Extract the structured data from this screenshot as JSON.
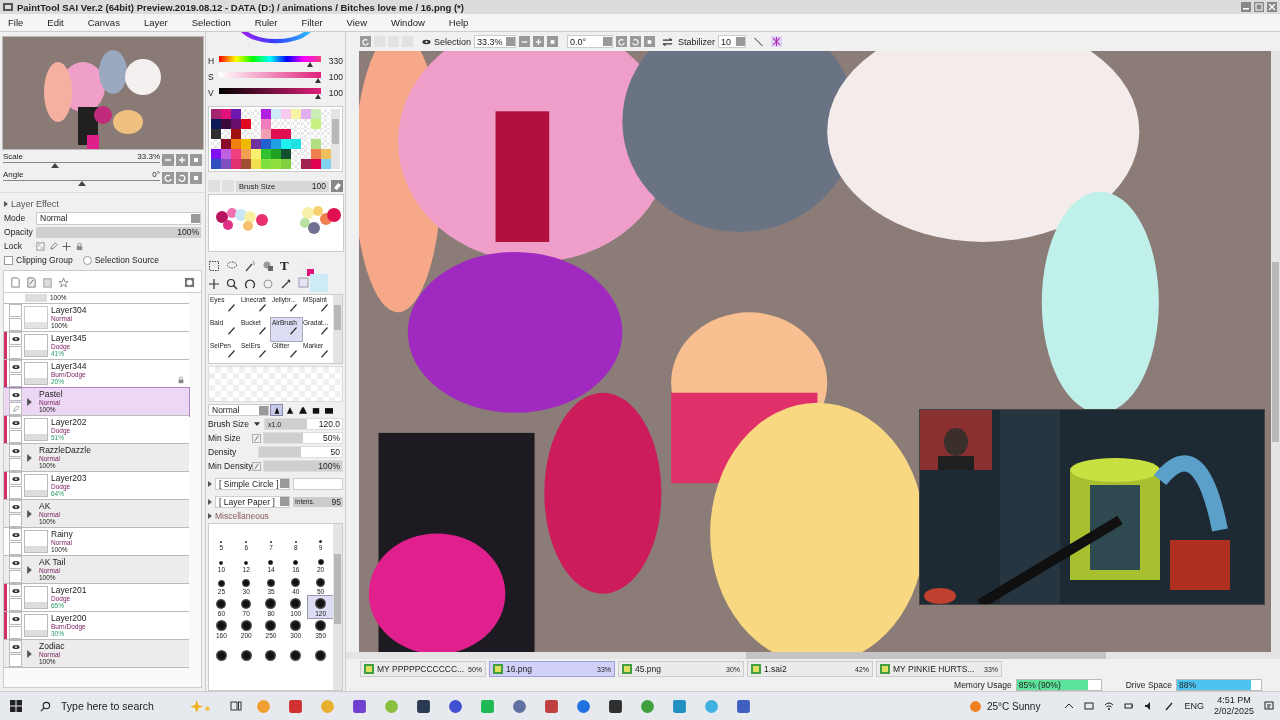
{
  "window": {
    "title": "PaintTool SAI Ver.2 (64bit) Preview.2019.08.12 - DATA (D:) / animations / Bitches love me / 16.png (*)"
  },
  "menu": [
    "File",
    "Edit",
    "Canvas",
    "Layer",
    "Selection",
    "Ruler",
    "Filter",
    "View",
    "Window",
    "Help"
  ],
  "navigator": {
    "sliders": [
      {
        "label": "Scale",
        "value": "33.3%",
        "level": 0.33
      },
      {
        "label": "Angle",
        "value": "0°",
        "level": 0.5
      }
    ]
  },
  "layer_panel": {
    "effect": {
      "label": "Layer Effect",
      "expanded": false
    },
    "mode": {
      "label": "Mode",
      "value": "Normal"
    },
    "opacity": {
      "label": "Opacity",
      "value": "100%",
      "level": 1
    },
    "lock_label": "Lock",
    "clipping_group": {
      "label": "Clipping Group",
      "checked": false
    },
    "selection_source": {
      "label": "Selection Source",
      "selected": false
    },
    "layers": [
      {
        "kind": "partial",
        "opacity": "100%",
        "visible": false,
        "clipped": false,
        "selected": false,
        "locked": false
      },
      {
        "kind": "layer",
        "name": "Layer304",
        "mode": "Normal",
        "opacity": "100%",
        "visible": false,
        "clipped": false,
        "selected": false,
        "locked": false
      },
      {
        "kind": "layer",
        "name": "Layer345",
        "mode": "Dodge",
        "opacity": "41%",
        "visible": true,
        "clipped": true,
        "selected": false,
        "locked": false
      },
      {
        "kind": "layer",
        "name": "Layer344",
        "mode": "Burn/Dodge",
        "opacity": "20%",
        "visible": true,
        "clipped": true,
        "selected": false,
        "locked": true
      },
      {
        "kind": "folder",
        "name": "Pastel",
        "mode": "Normal",
        "opacity": "100%",
        "visible": true,
        "clipped": false,
        "selected": true,
        "locked": false
      },
      {
        "kind": "layer",
        "name": "Layer202",
        "mode": "Dodge",
        "opacity": "51%",
        "visible": true,
        "clipped": true,
        "selected": false,
        "locked": false
      },
      {
        "kind": "folder",
        "name": "RazzleDazzle",
        "mode": "Normal",
        "opacity": "100%",
        "visible": true,
        "clipped": false,
        "selected": false,
        "locked": false
      },
      {
        "kind": "layer",
        "name": "Layer203",
        "mode": "Dodge",
        "opacity": "64%",
        "visible": true,
        "clipped": true,
        "selected": false,
        "locked": false
      },
      {
        "kind": "folder",
        "name": "AK",
        "mode": "Normal",
        "opacity": "100%",
        "visible": true,
        "clipped": false,
        "selected": false,
        "locked": false
      },
      {
        "kind": "layer",
        "name": "Rainy",
        "mode": "Normal",
        "opacity": "100%",
        "visible": true,
        "clipped": false,
        "selected": false,
        "locked": false
      },
      {
        "kind": "folder",
        "name": "AK Tail",
        "mode": "Normal",
        "opacity": "100%",
        "visible": true,
        "clipped": false,
        "selected": false,
        "locked": false
      },
      {
        "kind": "layer",
        "name": "Layer201",
        "mode": "Dodge",
        "opacity": "65%",
        "visible": true,
        "clipped": true,
        "selected": false,
        "locked": false
      },
      {
        "kind": "layer",
        "name": "Layer200",
        "mode": "Burn/Dodge",
        "opacity": "30%",
        "visible": true,
        "clipped": true,
        "selected": false,
        "locked": false
      },
      {
        "kind": "folder",
        "name": "Zodiac",
        "mode": "Normal",
        "opacity": "100%",
        "visible": true,
        "clipped": false,
        "selected": false,
        "locked": false
      }
    ]
  },
  "color": {
    "sliders": [
      {
        "label": "H",
        "value": "330",
        "level": 0.92
      },
      {
        "label": "S",
        "value": "100",
        "level": 1
      },
      {
        "label": "V",
        "value": "100",
        "level": 1
      }
    ],
    "swatches": [
      [
        {
          "filled": true,
          "color": "#a3246f"
        },
        {
          "filled": true,
          "color": "#e0137a"
        },
        {
          "filled": true,
          "color": "#6c18b0"
        },
        {
          "filled": false
        },
        {
          "filled": false
        },
        {
          "filled": true,
          "color": "#b11fe0"
        },
        {
          "filled": true,
          "color": "#cdeaf7"
        },
        {
          "filled": true,
          "color": "#f7c9ee"
        },
        {
          "filled": true,
          "color": "#f8f2a2"
        },
        {
          "filled": true,
          "color": "#e2aef2"
        },
        {
          "filled": true,
          "color": "#c9efb7"
        },
        {
          "filled": false
        }
      ],
      [
        {
          "filled": true,
          "color": "#0c1a5a"
        },
        {
          "filled": true,
          "color": "#3a0a3a"
        },
        {
          "filled": true,
          "color": "#6a0c6a"
        },
        {
          "filled": true,
          "color": "#e00820"
        },
        {
          "filled": false
        },
        {
          "filled": true,
          "color": "#f07cc0"
        },
        {
          "filled": false
        },
        {
          "filled": false
        },
        {
          "filled": false
        },
        {
          "filled": false
        },
        {
          "filled": true,
          "color": "#c8f080"
        },
        {
          "filled": false
        }
      ],
      [
        {
          "filled": true,
          "color": "#303030"
        },
        {
          "filled": false
        },
        {
          "filled": true,
          "color": "#a01010"
        },
        {
          "filled": false
        },
        {
          "filled": false
        },
        {
          "filled": true,
          "color": "#f0a0b0"
        },
        {
          "filled": true,
          "color": "#e01050"
        },
        {
          "filled": true,
          "color": "#e01050"
        },
        {
          "filled": false
        },
        {
          "filled": false
        },
        {
          "filled": false
        },
        {
          "filled": false
        }
      ],
      [
        {
          "filled": false
        },
        {
          "filled": true,
          "color": "#8a0a2a"
        },
        {
          "filled": true,
          "color": "#f08010"
        },
        {
          "filled": true,
          "color": "#f0b800"
        },
        {
          "filled": true,
          "color": "#7030a0"
        },
        {
          "filled": true,
          "color": "#2060d0"
        },
        {
          "filled": true,
          "color": "#20a0e0"
        },
        {
          "filled": true,
          "color": "#20f0f0"
        },
        {
          "filled": true,
          "color": "#20e0e0"
        },
        {
          "filled": false
        },
        {
          "filled": true,
          "color": "#b0e080"
        },
        {
          "filled": false
        }
      ],
      [
        {
          "filled": true,
          "color": "#8010f0"
        },
        {
          "filled": true,
          "color": "#c060e0"
        },
        {
          "filled": true,
          "color": "#f04080"
        },
        {
          "filled": true,
          "color": "#f0a050"
        },
        {
          "filled": true,
          "color": "#f8f070"
        },
        {
          "filled": true,
          "color": "#30c030"
        },
        {
          "filled": true,
          "color": "#20a020"
        },
        {
          "filled": true,
          "color": "#105030"
        },
        {
          "filled": false
        },
        {
          "filled": false
        },
        {
          "filled": true,
          "color": "#f08050"
        },
        {
          "filled": true,
          "color": "#f0c060"
        }
      ],
      [
        {
          "filled": true,
          "color": "#3050c0"
        },
        {
          "filled": true,
          "color": "#8050c0"
        },
        {
          "filled": true,
          "color": "#e03070"
        },
        {
          "filled": true,
          "color": "#a05030"
        },
        {
          "filled": true,
          "color": "#f0e050"
        },
        {
          "filled": true,
          "color": "#80e040"
        },
        {
          "filled": true,
          "color": "#90e040"
        },
        {
          "filled": true,
          "color": "#80d040"
        },
        {
          "filled": false
        },
        {
          "filled": true,
          "color": "#a02050"
        },
        {
          "filled": true,
          "color": "#e00050"
        },
        {
          "filled": true,
          "color": "#80d0f0"
        }
      ]
    ]
  },
  "brush_size": {
    "label": "Brush Size",
    "value": "100"
  },
  "tools": {
    "text_tool": "T"
  },
  "brushes": [
    {
      "name": "Eyes",
      "selected": false
    },
    {
      "name": "Linecraft",
      "selected": false
    },
    {
      "name": "Jellybr...",
      "selected": false
    },
    {
      "name": "MSpaint",
      "selected": false
    },
    {
      "name": "Bald",
      "selected": false
    },
    {
      "name": "Bucket",
      "selected": false
    },
    {
      "name": "AirBrush",
      "selected": true
    },
    {
      "name": "Gradat...",
      "selected": false
    },
    {
      "name": "SelPen",
      "selected": false
    },
    {
      "name": "SelErs",
      "selected": false
    },
    {
      "name": "Glitter",
      "selected": false
    },
    {
      "name": "Marker",
      "selected": false
    }
  ],
  "brush_settings": {
    "blend_mode": "Normal",
    "tips": [
      {
        "selected": true
      },
      {
        "selected": false
      },
      {
        "selected": false
      },
      {
        "selected": false
      },
      {
        "selected": false
      }
    ],
    "rows": [
      {
        "label": "Brush Size",
        "multiplier": "x1.0",
        "value": "120.0",
        "level": 0.55
      },
      {
        "label": "Min Size",
        "value": "50%",
        "level": 0.5
      },
      {
        "label": "Density",
        "value": "50",
        "level": 0.5
      },
      {
        "label": "Min Density",
        "value": "100%",
        "level": 1
      }
    ],
    "shape": "[ Simple Circle ]",
    "texture": "[ Layer Paper ]",
    "intensity_label": "Intens.",
    "intensity": "95",
    "misc": "Miscellaneous",
    "sizes": [
      {
        "label": "5",
        "selected": false
      },
      {
        "label": "6",
        "selected": false
      },
      {
        "label": "7",
        "selected": false
      },
      {
        "label": "8",
        "selected": false
      },
      {
        "label": "9",
        "selected": false
      },
      {
        "label": "10",
        "selected": false
      },
      {
        "label": "12",
        "selected": false
      },
      {
        "label": "14",
        "selected": false
      },
      {
        "label": "16",
        "selected": false
      },
      {
        "label": "20",
        "selected": false
      },
      {
        "label": "25",
        "selected": false
      },
      {
        "label": "30",
        "selected": false
      },
      {
        "label": "35",
        "selected": false
      },
      {
        "label": "40",
        "selected": false
      },
      {
        "label": "50",
        "selected": false
      },
      {
        "label": "60",
        "selected": false
      },
      {
        "label": "70",
        "selected": false
      },
      {
        "label": "80",
        "selected": false
      },
      {
        "label": "100",
        "selected": false
      },
      {
        "label": "120",
        "selected": true
      },
      {
        "label": "160",
        "selected": false
      },
      {
        "label": "200",
        "selected": false
      },
      {
        "label": "250",
        "selected": false
      },
      {
        "label": "300",
        "selected": false
      },
      {
        "label": "350",
        "selected": false
      }
    ]
  },
  "canvas_toolbar": {
    "selection": "Selection",
    "zoom": "33.3%",
    "angle": "0.0°",
    "stabilizer_label": "Stabilizer",
    "stabilizer": "10"
  },
  "documents": [
    {
      "name": "MY PPPPPCCCCCC...",
      "zoom": "50%",
      "selected": false
    },
    {
      "name": "16.png",
      "zoom": "33%",
      "selected": true
    },
    {
      "name": "45.png",
      "zoom": "30%",
      "selected": false
    },
    {
      "name": "1.sai2",
      "zoom": "42%",
      "selected": false
    },
    {
      "name": "MY PINKIE HURTS...",
      "zoom": "33%",
      "selected": false
    }
  ],
  "status": {
    "memory": {
      "label": "Memory Usage",
      "value": "85% (90%)",
      "level": 0.85
    },
    "drive": {
      "label": "Drive Space",
      "value": "88%",
      "level": 0.88
    }
  },
  "taskbar": {
    "search_placeholder": "Type here to search",
    "weather": "25°C Sunny",
    "language": "ENG",
    "time": "4:51 PM",
    "date": "2/02/2025"
  }
}
